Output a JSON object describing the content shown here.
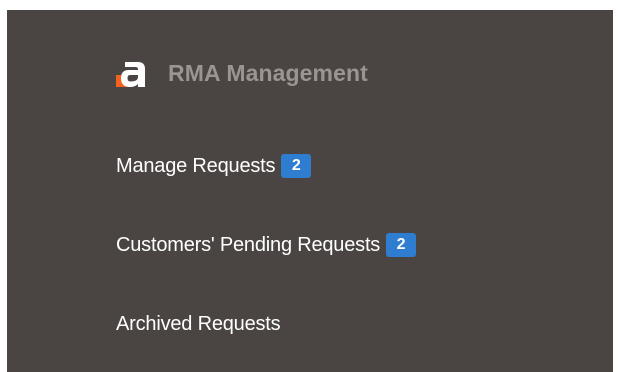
{
  "menu": {
    "logo_icon": "orange-a-logo-icon",
    "logo_colors": {
      "square": "#f26322",
      "letter": "#ffffff"
    },
    "title": "RMA Management",
    "items": [
      {
        "label": "Manage Requests",
        "badge": "2"
      },
      {
        "label": "Customers' Pending Requests",
        "badge": "2"
      },
      {
        "label": "Archived Requests",
        "badge": null
      }
    ]
  },
  "colors": {
    "panel_background": "#4a4542",
    "title_text": "#9a9591",
    "item_text": "#ffffff",
    "badge_background": "#2e7dd1"
  }
}
